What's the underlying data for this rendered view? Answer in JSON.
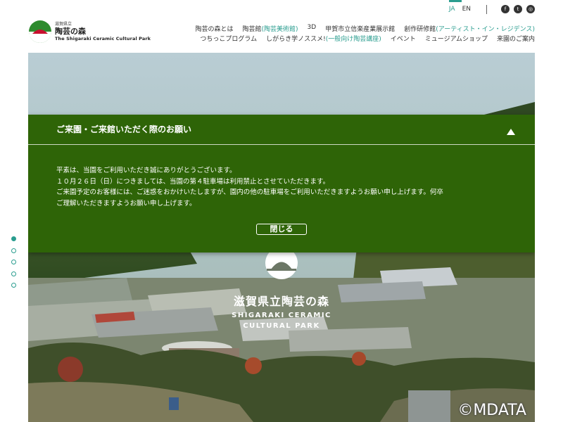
{
  "header": {
    "logo": {
      "small": "滋賀県立",
      "main": "陶芸の森",
      "en": "The Shigaraki Ceramic Cultural Park"
    },
    "languages": [
      {
        "label": "JA",
        "active": true
      },
      {
        "label": "EN",
        "active": false
      }
    ],
    "sns_icons": [
      "facebook-icon",
      "twitter-icon",
      "instagram-icon"
    ],
    "nav_row1": [
      {
        "label": "陶芸の森とは",
        "sub": ""
      },
      {
        "label": "陶芸館",
        "sub": "(陶芸美術館)"
      },
      {
        "label": "3D",
        "sub": ""
      },
      {
        "label": "甲賀市立信楽産業展示館",
        "sub": ""
      },
      {
        "label": "創作研修館",
        "sub": "(アーティスト・イン・レジデンス)"
      }
    ],
    "nav_row2": [
      {
        "label": "つちっこプログラム",
        "sub": ""
      },
      {
        "label": "しがらき学ノススメ!",
        "sub": "(一般向け陶芸講座)"
      },
      {
        "label": "イベント",
        "sub": ""
      },
      {
        "label": "ミュージアムショップ",
        "sub": ""
      },
      {
        "label": "来園のご案内",
        "sub": ""
      }
    ]
  },
  "hero": {
    "title": "滋賀県立陶芸の森",
    "en_line1": "SHIGARAKI CERAMIC",
    "en_line2": "CULTURAL PARK",
    "slides": 5,
    "active_slide": 0,
    "watermark": "©MDATA"
  },
  "notice": {
    "title": "ご来園・ご来館いただく際のお願い",
    "body": [
      "平素は、当園をご利用いただき誠にありがとうございます。",
      "１０月２６日（日）につきましては、当園の第４駐車場は利用禁止とさせていただきます。",
      "ご来園予定のお客様には、ご迷惑をおかけいたしますが、園内の他の駐車場をご利用いただきますようお願い申し上げます。何卒",
      "ご理解いただきますようお願い申し上げます。"
    ],
    "close_label": "閉じる"
  },
  "colors": {
    "accent": "#2a9d8f",
    "notice_bg": "#2e6407",
    "logo_green": "#2e8b2e",
    "logo_red": "#c8102e"
  }
}
